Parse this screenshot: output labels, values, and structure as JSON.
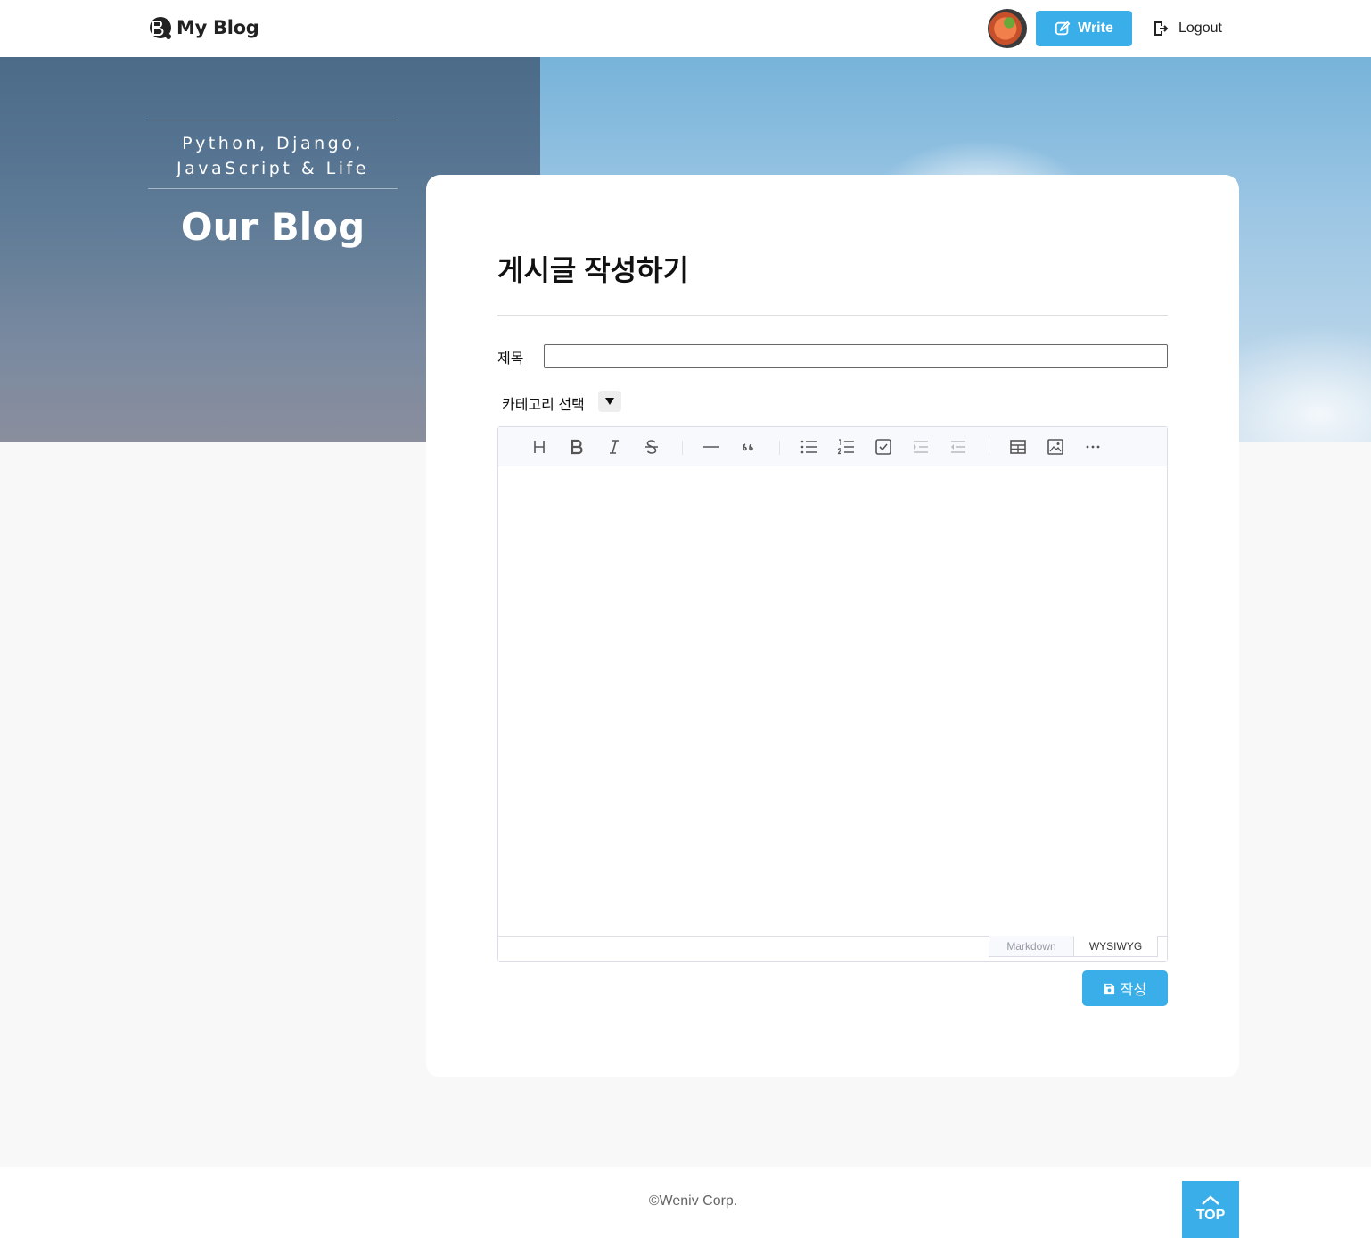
{
  "header": {
    "logo_text": "My Blog",
    "write_label": "Write",
    "logout_label": "Logout",
    "accent_color": "#3aaee8"
  },
  "hero": {
    "tagline_line1": "Python, Django,",
    "tagline_line2": "JavaScript & Life",
    "title": "Our Blog"
  },
  "form": {
    "page_title": "게시글 작성하기",
    "title_label": "제목",
    "title_value": "",
    "category_label": "카테고리 선택",
    "submit_label": "작성"
  },
  "editor": {
    "toolbar_icons": [
      "heading-icon",
      "bold-icon",
      "italic-icon",
      "strike-icon",
      "hr-icon",
      "quote-icon",
      "bullet-list-icon",
      "ordered-list-icon",
      "task-list-icon",
      "indent-icon",
      "outdent-icon",
      "table-icon",
      "image-icon",
      "more-icon"
    ],
    "mode_markdown": "Markdown",
    "mode_wysiwyg": "WYSIWYG",
    "active_mode": "WYSIWYG",
    "content": ""
  },
  "footer": {
    "copyright": "©Weniv Corp.",
    "top_label": "TOP"
  }
}
